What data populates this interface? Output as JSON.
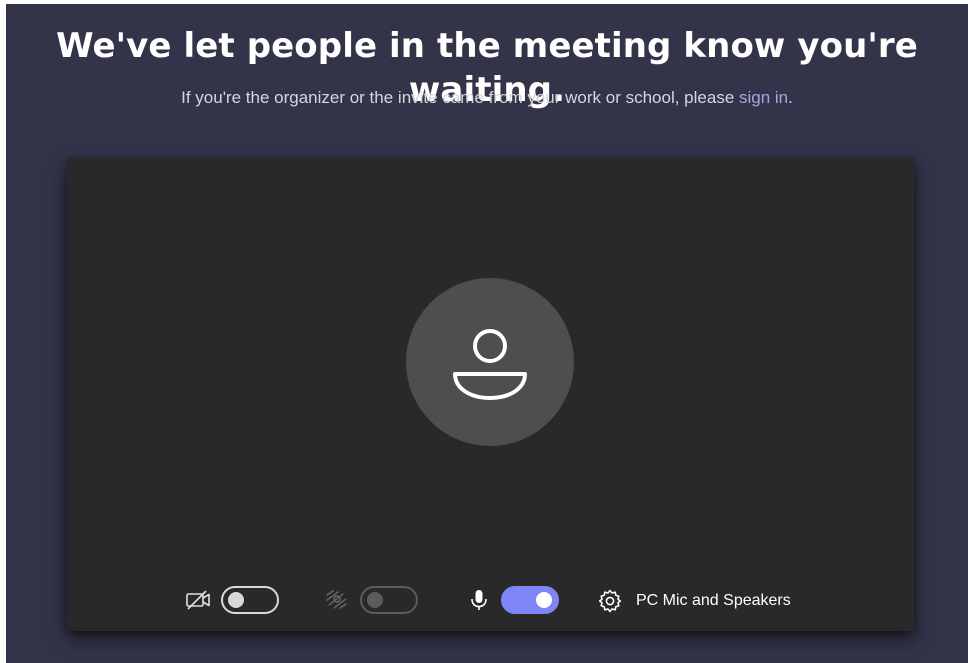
{
  "header": {
    "title": "We've let people in the meeting know you're waiting.",
    "subtitle_text": "If you're the organizer or the invite came from your work or school, please ",
    "sign_in_link": "sign in",
    "subtitle_end": "."
  },
  "preview": {
    "avatar_icon": "person-icon"
  },
  "controls": {
    "camera": {
      "icon": "camera-off-icon",
      "state": "off"
    },
    "background_effects": {
      "icon": "background-blur-icon",
      "state": "off",
      "enabled": false
    },
    "microphone": {
      "icon": "microphone-icon",
      "state": "on"
    },
    "device_settings": {
      "icon": "gear-icon",
      "label": "PC Mic and Speakers"
    }
  },
  "colors": {
    "app_background": "#33344a",
    "preview_background": "#292929",
    "avatar_background": "#4f4e4e",
    "accent": "#7f85f5",
    "link": "#a6a7dc"
  }
}
